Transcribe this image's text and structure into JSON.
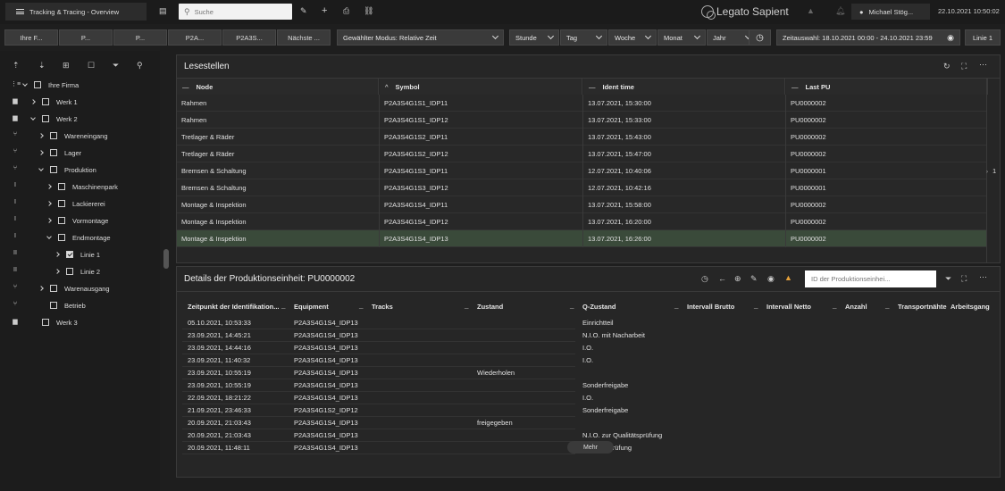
{
  "topbar": {
    "menu_label": "Tracking & Tracing - Overview",
    "search_placeholder": "Suche",
    "logo_text": "Legato Sapient",
    "user": "Michael Stög...",
    "datetime": "22.10.2021 10:50:02"
  },
  "toolbar": {
    "tabs": [
      "Ihre F...",
      "P...",
      "P...",
      "P2A...",
      "P2A3S...",
      "Nächste ..."
    ],
    "mode": "Gewählter Modus: Relative Zeit",
    "units": [
      "Stunde",
      "Tag",
      "Woche",
      "Monat",
      "Jahr"
    ],
    "time_range": "Zeitauswahl: 18.10.2021 00:00 - 24.10.2021 23:59",
    "line": "Linie 1"
  },
  "tree": [
    {
      "label": "Ihre Firma",
      "level": 0,
      "arrow": "down",
      "checked": false,
      "icon": "tree-icon"
    },
    {
      "label": "Werk 1",
      "level": 1,
      "arrow": "right",
      "checked": false,
      "icon": "factory-icon"
    },
    {
      "label": "Werk 2",
      "level": 1,
      "arrow": "down",
      "checked": false,
      "icon": "factory-icon"
    },
    {
      "label": "Wareneingang",
      "level": 2,
      "arrow": "right",
      "checked": false,
      "icon": "branch-icon"
    },
    {
      "label": "Lager",
      "level": 2,
      "arrow": "right",
      "checked": false,
      "icon": "branch-icon"
    },
    {
      "label": "Produktion",
      "level": 2,
      "arrow": "down",
      "checked": false,
      "icon": "branch-icon"
    },
    {
      "label": "Maschinenpark",
      "level": 3,
      "arrow": "right",
      "checked": false,
      "icon": "line-icon"
    },
    {
      "label": "Lackiererei",
      "level": 3,
      "arrow": "right",
      "checked": false,
      "icon": "line-icon"
    },
    {
      "label": "Vormontage",
      "level": 3,
      "arrow": "right",
      "checked": false,
      "icon": "line-icon"
    },
    {
      "label": "Endmontage",
      "level": 3,
      "arrow": "down",
      "checked": false,
      "icon": "line-icon"
    },
    {
      "label": "Linie 1",
      "level": 4,
      "arrow": "right",
      "checked": true,
      "icon": "double-line-icon"
    },
    {
      "label": "Linie 2",
      "level": 4,
      "arrow": "right",
      "checked": false,
      "icon": "double-line-icon"
    },
    {
      "label": "Warenausgang",
      "level": 2,
      "arrow": "right",
      "checked": false,
      "icon": "branch-icon"
    },
    {
      "label": "Betrieb",
      "level": 2,
      "arrow": "none",
      "checked": false,
      "icon": "branch-icon"
    },
    {
      "label": "Werk 3",
      "level": 1,
      "arrow": "none",
      "checked": false,
      "icon": "factory-icon"
    }
  ],
  "lesestellen": {
    "title": "Lesestellen",
    "columns": [
      "Node",
      "Symbol",
      "Ident time",
      "Last PU"
    ],
    "rows": [
      [
        "Rahmen",
        "P2A3S4G1S1_IDP11",
        "13.07.2021, 15:30:00",
        "PU0000002"
      ],
      [
        "Rahmen",
        "P2A3S4G1S1_IDP12",
        "13.07.2021, 15:33:00",
        "PU0000002"
      ],
      [
        "Tretlager & Räder",
        "P2A3S4G1S2_IDP11",
        "13.07.2021, 15:43:00",
        "PU0000002"
      ],
      [
        "Tretlager & Räder",
        "P2A3S4G1S2_IDP12",
        "13.07.2021, 15:47:00",
        "PU0000002"
      ],
      [
        "Bremsen & Schaltung",
        "P2A3S4G1S3_IDP11",
        "12.07.2021, 10:40:06",
        "PU0000001"
      ],
      [
        "Bremsen & Schaltung",
        "P2A3S4G1S3_IDP12",
        "12.07.2021, 10:42:16",
        "PU0000001"
      ],
      [
        "Montage & Inspektion",
        "P2A3S4G1S4_IDP11",
        "13.07.2021, 15:58:00",
        "PU0000002"
      ],
      [
        "Montage & Inspektion",
        "P2A3S4G1S4_IDP12",
        "13.07.2021, 16:20:00",
        "PU0000002"
      ],
      [
        "Montage & Inspektion",
        "P2A3S4G1S4_IDP13",
        "13.07.2021, 16:26:00",
        "PU0000002"
      ]
    ],
    "page_indicator": "1"
  },
  "details": {
    "title": "Details der Produktionseinheit: PU0000002",
    "search_placeholder": "ID der Produktionseinhei...",
    "columns": [
      "Zeitpunkt der Identifikation...",
      "Equipment",
      "Tracks",
      "Zustand",
      "Q-Zustand",
      "Intervall Brutto",
      "Intervall Netto",
      "Anzahl",
      "Transportnähte",
      "Arbeitsgang"
    ],
    "rows": [
      [
        "05.10.2021, 10:53:33",
        "P2A3S4G1S4_IDP13",
        "",
        "",
        "Einrichtteil"
      ],
      [
        "23.09.2021, 14:45:21",
        "P2A3S4G1S4_IDP13",
        "",
        "",
        "N.I.O. mit Nacharbeit"
      ],
      [
        "23.09.2021, 14:44:16",
        "P2A3S4G1S4_IDP13",
        "",
        "",
        "I.O."
      ],
      [
        "23.09.2021, 11:40:32",
        "P2A3S4G1S4_IDP13",
        "",
        "",
        "I.O."
      ],
      [
        "23.09.2021, 10:55:19",
        "P2A3S4G1S4_IDP13",
        "",
        "Wiederholen",
        ""
      ],
      [
        "23.09.2021, 10:55:19",
        "P2A3S4G1S4_IDP13",
        "",
        "",
        "Sonderfreigabe"
      ],
      [
        "22.09.2021, 18:21:22",
        "P2A3S4G1S4_IDP13",
        "",
        "",
        "I.O."
      ],
      [
        "21.09.2021, 23:46:33",
        "P2A3S4G1S2_IDP12",
        "",
        "",
        "Sonderfreigabe"
      ],
      [
        "20.09.2021, 21:03:43",
        "P2A3S4G1S4_IDP13",
        "",
        "freigegeben",
        ""
      ],
      [
        "20.09.2021, 21:03:43",
        "P2A3S4G1S4_IDP13",
        "",
        "",
        "N.I.O. zur Qualitätsprüfung"
      ],
      [
        "20.09.2021, 11:48:11",
        "P2A3S4G1S4_IDP13",
        "",
        "",
        "Qualitätsprüfung"
      ]
    ],
    "more_label": "Mehr"
  },
  "colors": {
    "selected_row": "#3a4a3a",
    "warning": "#e8a23a"
  }
}
